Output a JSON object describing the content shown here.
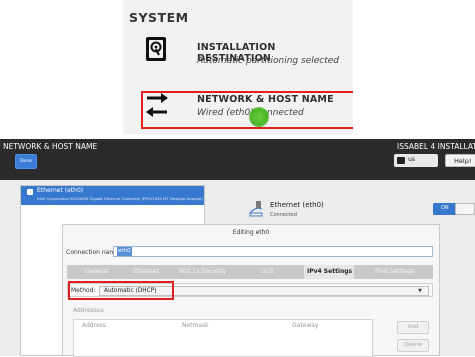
{
  "system_panel": {
    "section_title": "SYSTEM",
    "installation_destination": {
      "title": "INSTALLATION DESTINATION",
      "subtitle": "Automatic partitioning selected"
    },
    "network_host_name": {
      "title": "NETWORK & HOST NAME",
      "subtitle": "Wired (eth0) connected"
    }
  },
  "header": {
    "title": "NETWORK & HOST NAME",
    "done_label": "Done",
    "product_title": "ISSABEL 4 INSTALLATION",
    "keyboard_layout": "us",
    "help_label": "Help!"
  },
  "device_list": {
    "items": [
      {
        "name": "Ethernet (eth0)",
        "description": "Intel Corporation 82540EM Gigabit Ethernet Controller (PRO/1000 MT Desktop Adapter)"
      }
    ]
  },
  "device_detail": {
    "name": "Ethernet (eth0)",
    "status": "Connected",
    "toggle_label": "ON"
  },
  "editing_dialog": {
    "title": "Editing eth0",
    "connection_name_label": "Connection name:",
    "connection_name_value": "eth0",
    "tabs": [
      "General",
      "Ethernet",
      "802.1x Security",
      "DCB",
      "IPv4 Settings",
      "IPv6 Settings"
    ],
    "active_tab": "IPv4 Settings",
    "method_label": "Method:",
    "method_value": "Automatic (DHCP)",
    "addresses_title": "Addresses",
    "addresses_columns": [
      "Address",
      "Netmask",
      "Gateway"
    ],
    "add_label": "Add",
    "delete_label": "Delete"
  },
  "colors": {
    "highlight_red": "#e01f1f",
    "accent_blue": "#3778cf",
    "header_dark": "#2b2b2b"
  },
  "icons": [
    "disk-icon",
    "network-arrows-icon",
    "cursor-indicator",
    "ethernet-icon",
    "keyboard-icon"
  ]
}
